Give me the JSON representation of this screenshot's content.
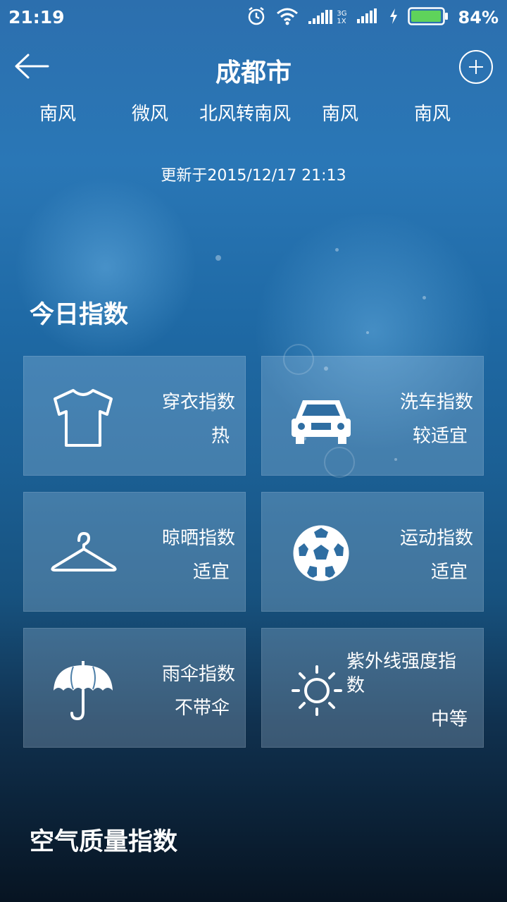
{
  "status_bar": {
    "time": "21:19",
    "network": "3G\n1X",
    "battery": "84%",
    "icons": [
      "alarm-icon",
      "wifi-icon",
      "signal-icon",
      "charging-icon",
      "battery-icon"
    ]
  },
  "header": {
    "title": "成都市",
    "back_icon": "arrow-left-icon",
    "add_icon": "plus-circle-icon"
  },
  "wind_forecast": [
    "南风",
    "微风",
    "北风转南风",
    "南风",
    "南风"
  ],
  "updated": "更新于2015/12/17 21:13",
  "today_index": {
    "title": "今日指数",
    "cards": [
      {
        "name": "穿衣指数",
        "value": "热",
        "icon": "tshirt-icon"
      },
      {
        "name": "洗车指数",
        "value": "较适宜",
        "icon": "car-icon"
      },
      {
        "name": "晾晒指数",
        "value": "适宜",
        "icon": "hanger-icon"
      },
      {
        "name": "运动指数",
        "value": "适宜",
        "icon": "soccer-ball-icon"
      },
      {
        "name": "雨伞指数",
        "value": "不带伞",
        "icon": "umbrella-icon"
      },
      {
        "name": "紫外线强度指数",
        "value": "中等",
        "icon": "sun-icon"
      }
    ]
  },
  "air_quality": {
    "title": "空气质量指数"
  },
  "colors": {
    "card_bg": "#6f9ac0",
    "text": "#ffffff",
    "accent_battery": "#5fd35b"
  }
}
